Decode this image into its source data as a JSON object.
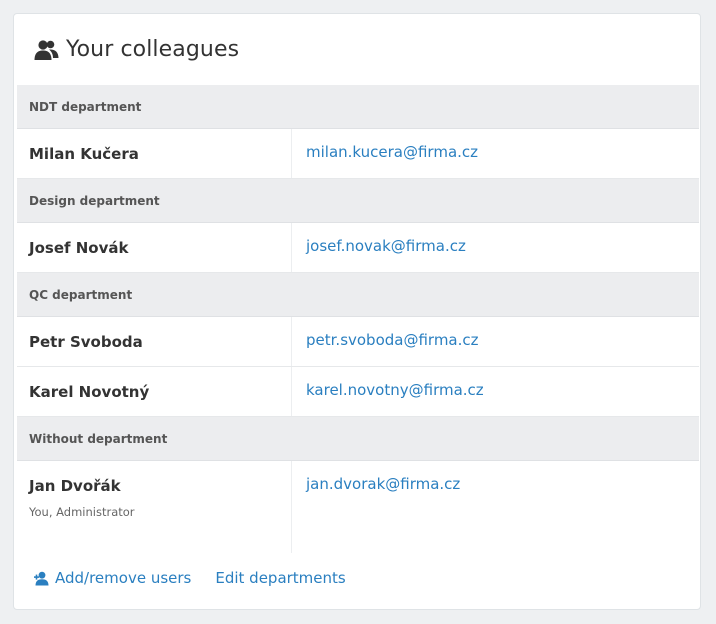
{
  "header": {
    "title": "Your colleagues",
    "icon": "users-icon"
  },
  "colors": {
    "accent": "#2a7fc0",
    "department_bg": "#ecedef"
  },
  "departments": [
    {
      "name": "NDT department",
      "members": [
        {
          "name": "Milan Kučera",
          "email": "milan.kucera@firma.cz"
        }
      ]
    },
    {
      "name": "Design department",
      "members": [
        {
          "name": "Josef Novák",
          "email": "josef.novak@firma.cz"
        }
      ]
    },
    {
      "name": "QC department",
      "members": [
        {
          "name": "Petr Svoboda",
          "email": "petr.svoboda@firma.cz"
        },
        {
          "name": "Karel Novotný",
          "email": "karel.novotny@firma.cz"
        }
      ]
    },
    {
      "name": "Without department",
      "members": [
        {
          "name": "Jan Dvořák",
          "email": "jan.dvorak@firma.cz",
          "note": "You, Administrator"
        }
      ]
    }
  ],
  "actions": {
    "add_remove_users": "Add/remove users",
    "add_remove_icon": "add-user-icon",
    "edit_departments": "Edit departments"
  }
}
